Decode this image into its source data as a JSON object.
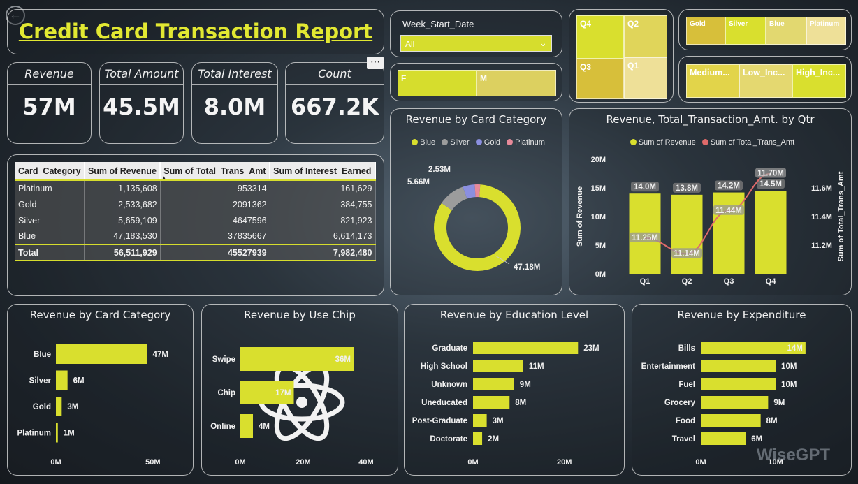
{
  "title": "Credit Card Transaction Report",
  "more_icon": "ellipsis-icon",
  "kpis": [
    {
      "label": "Revenue",
      "value": "57M"
    },
    {
      "label": "Total Amount",
      "value": "45.5M"
    },
    {
      "label": "Total Interest",
      "value": "8.0M"
    },
    {
      "label": "Count",
      "value": "667.2K"
    }
  ],
  "slicer": {
    "label": "Week_Start_Date",
    "value": "All"
  },
  "gender": [
    "F",
    "M"
  ],
  "quarters": [
    "Q4",
    "Q2",
    "Q3",
    "Q1"
  ],
  "card_tiles": [
    "Gold",
    "Silver",
    "Blue",
    "Platinum"
  ],
  "income_tiles": [
    "Medium...",
    "Low_Inc...",
    "High_Inc..."
  ],
  "table": {
    "headers": [
      "Card_Category",
      "Sum of Revenue",
      "Sum of Total_Trans_Amt",
      "Sum of Interest_Earned"
    ],
    "rows": [
      [
        "Platinum",
        "1,135,608",
        "953314",
        "161,629"
      ],
      [
        "Gold",
        "2,533,682",
        "2091362",
        "384,755"
      ],
      [
        "Silver",
        "5,659,109",
        "4647596",
        "821,923"
      ],
      [
        "Blue",
        "47,183,530",
        "37835667",
        "6,614,173"
      ]
    ],
    "total": [
      "Total",
      "56,511,929",
      "45527939",
      "7,982,480"
    ]
  },
  "colors": {
    "accent": "#d9df2e",
    "blue": "#8b8fe0",
    "silver": "#9c9c9c",
    "platinum": "#e88a9a",
    "line": "#e06a6a"
  },
  "watermark": "WiseGPT",
  "chart_data": [
    {
      "type": "pie",
      "title": "Revenue by Card Category",
      "legend": [
        "Blue",
        "Silver",
        "Gold",
        "Platinum"
      ],
      "categories": [
        "Blue",
        "Silver",
        "Gold",
        "Platinum"
      ],
      "values": [
        47.18,
        5.66,
        2.53,
        1.14
      ],
      "labels": [
        "47.18M",
        "5.66M",
        "2.53M",
        ""
      ]
    },
    {
      "type": "bar",
      "title": "Revenue, Total_Transaction_Amt. by Qtr",
      "legend": [
        "Sum of Revenue",
        "Sum of Total_Trans_Amt"
      ],
      "categories": [
        "Q1",
        "Q2",
        "Q3",
        "Q4"
      ],
      "series": [
        {
          "name": "Sum of Revenue",
          "values": [
            14.0,
            13.8,
            14.2,
            14.5
          ],
          "labels": [
            "14.0M",
            "13.8M",
            "14.2M",
            "14.5M"
          ]
        },
        {
          "name": "Sum of Total_Trans_Amt",
          "values": [
            11.25,
            11.14,
            11.44,
            11.7
          ],
          "labels": [
            "11.25M",
            "11.14M",
            "11.44M",
            "11.70M"
          ]
        }
      ],
      "ylabel": "Sum of Revenue",
      "y2label": "Sum of Total_Trans_Amt",
      "yticks": [
        "0M",
        "5M",
        "10M",
        "15M",
        "20M"
      ],
      "ylim": [
        0,
        20
      ],
      "y2ticks": [
        "11.2M",
        "11.4M",
        "11.6M"
      ],
      "y2lim": [
        11.0,
        11.8
      ]
    },
    {
      "type": "bar",
      "title": "Revenue by Card Category",
      "categories": [
        "Blue",
        "Silver",
        "Gold",
        "Platinum"
      ],
      "values": [
        47,
        6,
        3,
        1
      ],
      "labels": [
        "47M",
        "6M",
        "3M",
        "1M"
      ],
      "xticks": [
        "0M",
        "50M"
      ],
      "xlim": [
        0,
        54
      ]
    },
    {
      "type": "bar",
      "title": "Revenue by Use Chip",
      "categories": [
        "Swipe",
        "Chip",
        "Online"
      ],
      "values": [
        36,
        17,
        4
      ],
      "labels": [
        "36M",
        "17M",
        "4M"
      ],
      "xticks": [
        "0M",
        "20M",
        "40M"
      ],
      "xlim": [
        0,
        40
      ]
    },
    {
      "type": "bar",
      "title": "Revenue by Education Level",
      "categories": [
        "Graduate",
        "High School",
        "Unknown",
        "Uneducated",
        "Post-Graduate",
        "Doctorate"
      ],
      "values": [
        23,
        11,
        9,
        8,
        3,
        2
      ],
      "labels": [
        "23M",
        "11M",
        "9M",
        "8M",
        "3M",
        "2M"
      ],
      "xticks": [
        "0M",
        "20M"
      ],
      "xlim": [
        0,
        30
      ]
    },
    {
      "type": "bar",
      "title": "Revenue by Expenditure",
      "categories": [
        "Bills",
        "Entertainment",
        "Fuel",
        "Grocery",
        "Food",
        "Travel"
      ],
      "values": [
        14,
        10,
        10,
        9,
        8,
        6
      ],
      "labels": [
        "14M",
        "10M",
        "10M",
        "9M",
        "8M",
        "6M"
      ],
      "xticks": [
        "0M",
        "10M"
      ],
      "xlim": [
        0,
        17
      ]
    }
  ]
}
